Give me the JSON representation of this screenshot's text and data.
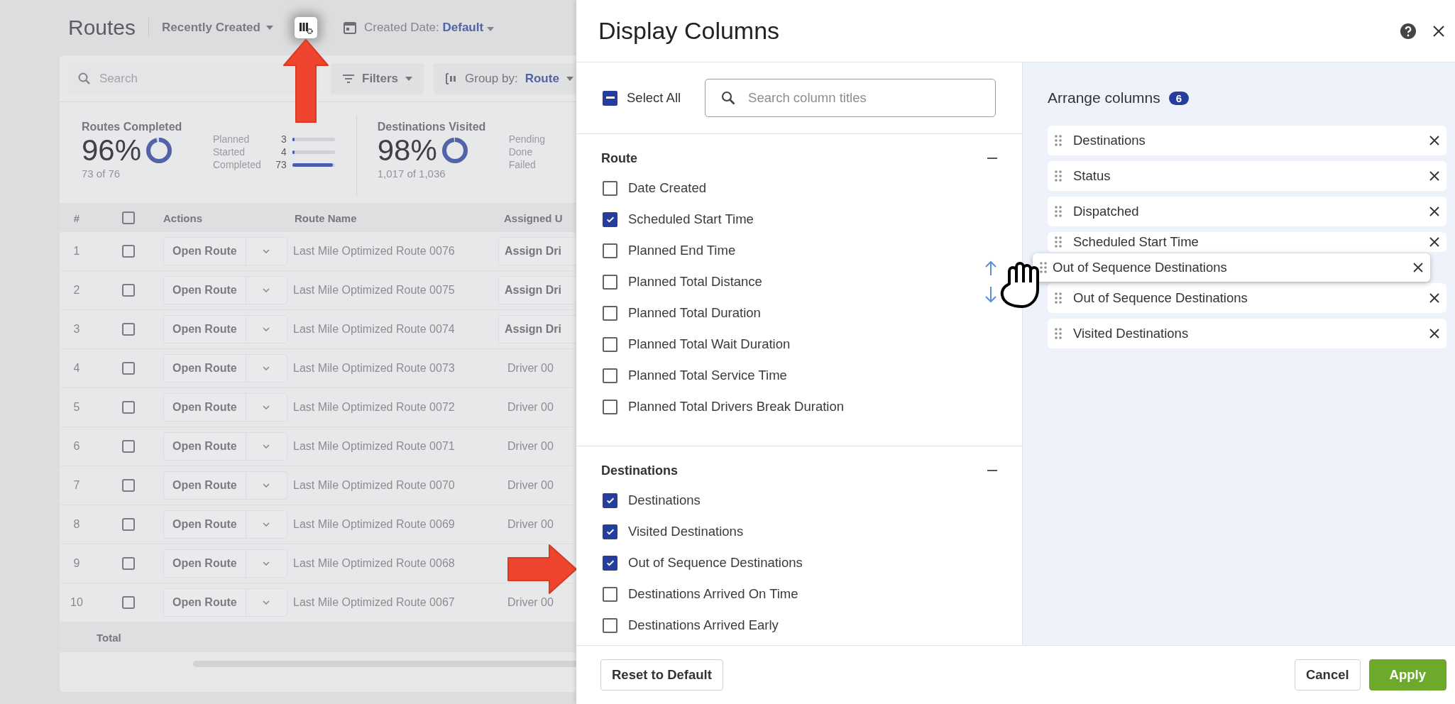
{
  "routes": {
    "title": "Routes",
    "sort": "Recently Created",
    "date_filter": {
      "label": "Created Date:",
      "value": "Default"
    }
  },
  "toolbar": {
    "search_placeholder": "Search",
    "filters": "Filters",
    "group_by": {
      "label": "Group by:",
      "value": "Route"
    }
  },
  "stats": [
    {
      "title": "Routes Completed",
      "percent": "96%",
      "level": 0.96,
      "sub": "73 of 76",
      "breakdown": [
        {
          "label": "Planned",
          "count": "3",
          "level": 0.05
        },
        {
          "label": "Started",
          "count": "4",
          "level": 0.06
        },
        {
          "label": "Completed",
          "count": "73",
          "level": 0.96
        }
      ]
    },
    {
      "title": "Destinations Visited",
      "percent": "98%",
      "level": 0.98,
      "sub": "1,017 of 1,036",
      "breakdown": [
        {
          "label": "Pending"
        },
        {
          "label": "Done"
        },
        {
          "label": "Failed"
        }
      ]
    }
  ],
  "table": {
    "columns": [
      "#",
      "Actions",
      "Route Name",
      "Assigned U"
    ],
    "header_checked": false,
    "rows": [
      {
        "number": "1",
        "checked": false,
        "action": "Open Route",
        "route_name": "Last Mile Optimized Route 0076",
        "assigned": {
          "kind": "button",
          "text": "Assign Dri"
        }
      },
      {
        "number": "2",
        "checked": false,
        "action": "Open Route",
        "route_name": "Last Mile Optimized Route 0075",
        "assigned": {
          "kind": "button",
          "text": "Assign Dri"
        }
      },
      {
        "number": "3",
        "checked": false,
        "action": "Open Route",
        "route_name": "Last Mile Optimized Route 0074",
        "assigned": {
          "kind": "button",
          "text": "Assign Dri"
        }
      },
      {
        "number": "4",
        "checked": false,
        "action": "Open Route",
        "route_name": "Last Mile Optimized Route 0073",
        "assigned": {
          "kind": "text",
          "text": "Driver 00"
        }
      },
      {
        "number": "5",
        "checked": false,
        "action": "Open Route",
        "route_name": "Last Mile Optimized Route 0072",
        "assigned": {
          "kind": "text",
          "text": "Driver 00"
        }
      },
      {
        "number": "6",
        "checked": false,
        "action": "Open Route",
        "route_name": "Last Mile Optimized Route 0071",
        "assigned": {
          "kind": "text",
          "text": "Driver 00"
        }
      },
      {
        "number": "7",
        "checked": false,
        "action": "Open Route",
        "route_name": "Last Mile Optimized Route 0070",
        "assigned": {
          "kind": "text",
          "text": "Driver 00"
        }
      },
      {
        "number": "8",
        "checked": false,
        "action": "Open Route",
        "route_name": "Last Mile Optimized Route 0069",
        "assigned": {
          "kind": "text",
          "text": "Driver 00"
        }
      },
      {
        "number": "9",
        "checked": false,
        "action": "Open Route",
        "route_name": "Last Mile Optimized Route 0068"
      },
      {
        "number": "10",
        "checked": false,
        "action": "Open Route",
        "route_name": "Last Mile Optimized Route 0067",
        "assigned": {
          "kind": "text",
          "text": "Driver 00"
        }
      }
    ],
    "total_label": "Total"
  },
  "panel": {
    "title": "Display Columns",
    "select_all": {
      "label": "Select All",
      "indeterminate": true
    },
    "search_placeholder": "Search column titles",
    "groups": [
      {
        "title": "Route",
        "expanded": true,
        "items": [
          {
            "label": "Date Created",
            "checked": false
          },
          {
            "label": "Scheduled Start Time",
            "checked": true
          },
          {
            "label": "Planned End Time",
            "checked": false
          },
          {
            "label": "Planned Total Distance",
            "checked": false
          },
          {
            "label": "Planned Total Duration",
            "checked": false
          },
          {
            "label": "Planned Total Wait Duration",
            "checked": false
          },
          {
            "label": "Planned Total Service Time",
            "checked": false
          },
          {
            "label": "Planned Total Drivers Break Duration",
            "checked": false
          }
        ]
      },
      {
        "title": "Destinations",
        "expanded": true,
        "items": [
          {
            "label": "Destinations",
            "checked": true
          },
          {
            "label": "Visited Destinations",
            "checked": true
          },
          {
            "label": "Out of Sequence Destinations",
            "checked": true
          },
          {
            "label": "Destinations Arrived On Time",
            "checked": false
          },
          {
            "label": "Destinations Arrived Early",
            "checked": false
          }
        ]
      }
    ],
    "arrange": {
      "title": "Arrange columns",
      "count": "6",
      "items": [
        "Destinations",
        "Status",
        "Dispatched",
        "Scheduled Start Time",
        "Out of Sequence Destinations",
        "Visited Destinations"
      ],
      "dragging": "Out of Sequence Destinations"
    },
    "footer": {
      "reset": "Reset to Default",
      "cancel": "Cancel",
      "apply": "Apply"
    }
  }
}
